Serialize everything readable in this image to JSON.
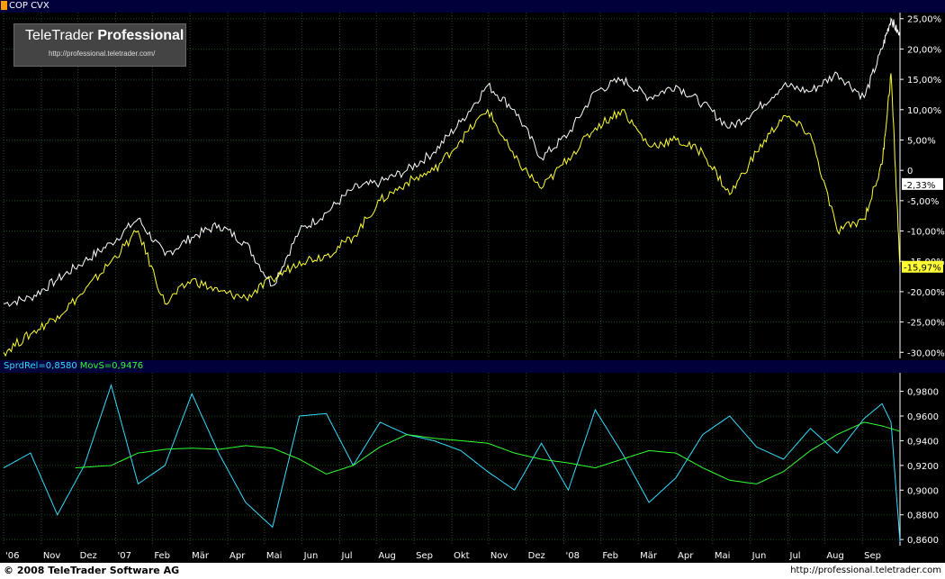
{
  "header": {
    "symbols": "COP CVX"
  },
  "logo": {
    "brand_light": "TeleTrader",
    "brand_bold": "Professional",
    "url": "http://professional.teletrader.com/"
  },
  "indicator": {
    "sprd_label": "SprdRel=0,8580",
    "movs_label": "MovS=0,9476"
  },
  "footer": {
    "copyright": "© 2008 TeleTrader Software AG",
    "url": "http://professional.teletrader.com"
  },
  "colors": {
    "cop": "#ffffff",
    "cvx": "#ffff33",
    "sprd": "#33ddff",
    "movs": "#33ff33",
    "grid": "#1e4d1e",
    "bar": "#00003a"
  },
  "chart_data": [
    {
      "type": "line",
      "ylim": [
        -31,
        26
      ],
      "y_ticks": [
        "25,00%",
        "20,00%",
        "15,00%",
        "10,00%",
        "5,00%",
        "0",
        "-5,00%",
        "-10,00%",
        "-15,00%",
        "-20,00%",
        "-25,00%",
        "-30,00%"
      ],
      "y_tick_values": [
        25,
        20,
        15,
        10,
        5,
        0,
        -5,
        -10,
        -15,
        -20,
        -25,
        -30
      ],
      "last_labels": [
        {
          "text": "-2,33%",
          "value": -2.33,
          "series": "COP"
        },
        {
          "text": "-15,97%",
          "value": -15.97,
          "series": "CVX"
        }
      ],
      "x_index_range": [
        0,
        100
      ],
      "series": [
        {
          "name": "COP",
          "x": [
            0,
            3,
            6,
            9,
            12,
            15,
            18,
            21,
            24,
            27,
            30,
            33,
            36,
            39,
            42,
            45,
            48,
            51,
            54,
            57,
            60,
            63,
            66,
            69,
            72,
            75,
            78,
            81,
            84,
            87,
            90,
            93,
            96,
            98,
            99,
            100
          ],
          "values": [
            -22,
            -21,
            -18,
            -15,
            -12,
            -8,
            -14,
            -11,
            -9,
            -12,
            -19,
            -10,
            -7,
            -3,
            -2,
            0,
            3,
            8,
            14,
            10,
            2,
            6,
            13,
            15,
            12,
            14,
            11,
            7,
            10,
            14,
            13,
            16,
            12,
            20,
            25,
            22
          ]
        },
        {
          "name": "CVX",
          "x": [
            0,
            3,
            6,
            9,
            12,
            15,
            18,
            21,
            24,
            27,
            30,
            33,
            36,
            39,
            42,
            45,
            48,
            51,
            54,
            57,
            60,
            63,
            66,
            69,
            72,
            75,
            78,
            81,
            84,
            87,
            90,
            93,
            96,
            98,
            99,
            100
          ],
          "values": [
            -30,
            -27,
            -24,
            -20,
            -15,
            -10,
            -22,
            -18,
            -20,
            -21,
            -18,
            -15,
            -14,
            -11,
            -5,
            -2,
            0,
            5,
            10,
            2,
            -3,
            2,
            7,
            10,
            4,
            5,
            3,
            -4,
            3,
            9,
            6,
            -10,
            -8,
            1,
            16,
            -16
          ]
        }
      ]
    },
    {
      "type": "line",
      "ylim": [
        0.855,
        0.995
      ],
      "y_ticks": [
        "0,9800",
        "0,9600",
        "0,9400",
        "0,9200",
        "0,9000",
        "0,8800",
        "0,8600"
      ],
      "y_tick_values": [
        0.98,
        0.96,
        0.94,
        0.92,
        0.9,
        0.88,
        0.86
      ],
      "x_ticks": [
        "'06",
        "Nov",
        "Dez",
        "'07",
        "Feb",
        "Mär",
        "Apr",
        "Mai",
        "Jun",
        "Jul",
        "Aug",
        "Sep",
        "Okt",
        "Nov",
        "Dez",
        "'08",
        "Feb",
        "Mär",
        "Apr",
        "Mai",
        "Jun",
        "Jul",
        "Aug",
        "Sep"
      ],
      "x_tick_positions": [
        0,
        4.2,
        8.3,
        12.5,
        16.6,
        20.8,
        25,
        29.1,
        33.3,
        37.5,
        41.6,
        45.8,
        50,
        54.1,
        58.3,
        62.5,
        66.6,
        70.8,
        75,
        79.1,
        83.3,
        87.5,
        91.6,
        95.8
      ],
      "series": [
        {
          "name": "SprdRel",
          "x": [
            0,
            3,
            6,
            9,
            12,
            15,
            18,
            21,
            24,
            27,
            30,
            33,
            36,
            39,
            42,
            45,
            48,
            51,
            54,
            57,
            60,
            63,
            66,
            69,
            72,
            75,
            78,
            81,
            84,
            87,
            90,
            93,
            96,
            98,
            99,
            100
          ],
          "values": [
            0.918,
            0.93,
            0.88,
            0.92,
            0.985,
            0.905,
            0.92,
            0.978,
            0.93,
            0.89,
            0.87,
            0.96,
            0.962,
            0.92,
            0.955,
            0.945,
            0.94,
            0.932,
            0.915,
            0.9,
            0.938,
            0.9,
            0.965,
            0.93,
            0.89,
            0.91,
            0.945,
            0.96,
            0.935,
            0.925,
            0.95,
            0.93,
            0.958,
            0.97,
            0.955,
            0.858
          ]
        },
        {
          "name": "MovS",
          "x": [
            8,
            12,
            15,
            18,
            21,
            24,
            27,
            30,
            33,
            36,
            39,
            42,
            45,
            48,
            51,
            54,
            57,
            60,
            63,
            66,
            69,
            72,
            75,
            78,
            81,
            84,
            87,
            90,
            93,
            96,
            98,
            100
          ],
          "values": [
            0.918,
            0.92,
            0.93,
            0.933,
            0.934,
            0.933,
            0.936,
            0.934,
            0.925,
            0.913,
            0.92,
            0.935,
            0.945,
            0.942,
            0.94,
            0.938,
            0.93,
            0.925,
            0.922,
            0.918,
            0.925,
            0.932,
            0.93,
            0.918,
            0.908,
            0.905,
            0.915,
            0.932,
            0.945,
            0.955,
            0.952,
            0.9476
          ]
        }
      ]
    }
  ]
}
